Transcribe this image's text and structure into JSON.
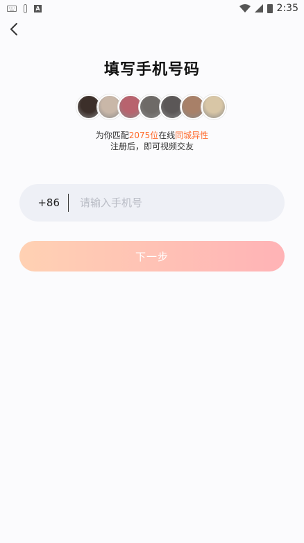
{
  "statusbar": {
    "time": "2:35",
    "icons": [
      "keyboard-icon",
      "thermometer-icon",
      "a-icon",
      "wifi-icon",
      "cellular-icon",
      "battery-icon"
    ]
  },
  "header": {
    "back_icon": "chevron-left-icon",
    "title": "填写手机号码"
  },
  "avatars": {
    "colors": [
      "#3c2f2a",
      "#c9b7a8",
      "#b8636e",
      "#6e6a67",
      "#5b5757",
      "#a88068",
      "#d8c6a6"
    ]
  },
  "promo": {
    "line1_prefix": "为你匹配",
    "count": "2075位",
    "line1_mid": "在线",
    "highlight": "同城异性",
    "line2": "注册后，即可视频交友",
    "highlight_color": "#ff6a2b"
  },
  "phone": {
    "country_code": "+86",
    "placeholder": "请输入手机号",
    "value": ""
  },
  "next_button": {
    "label": "下一步"
  }
}
